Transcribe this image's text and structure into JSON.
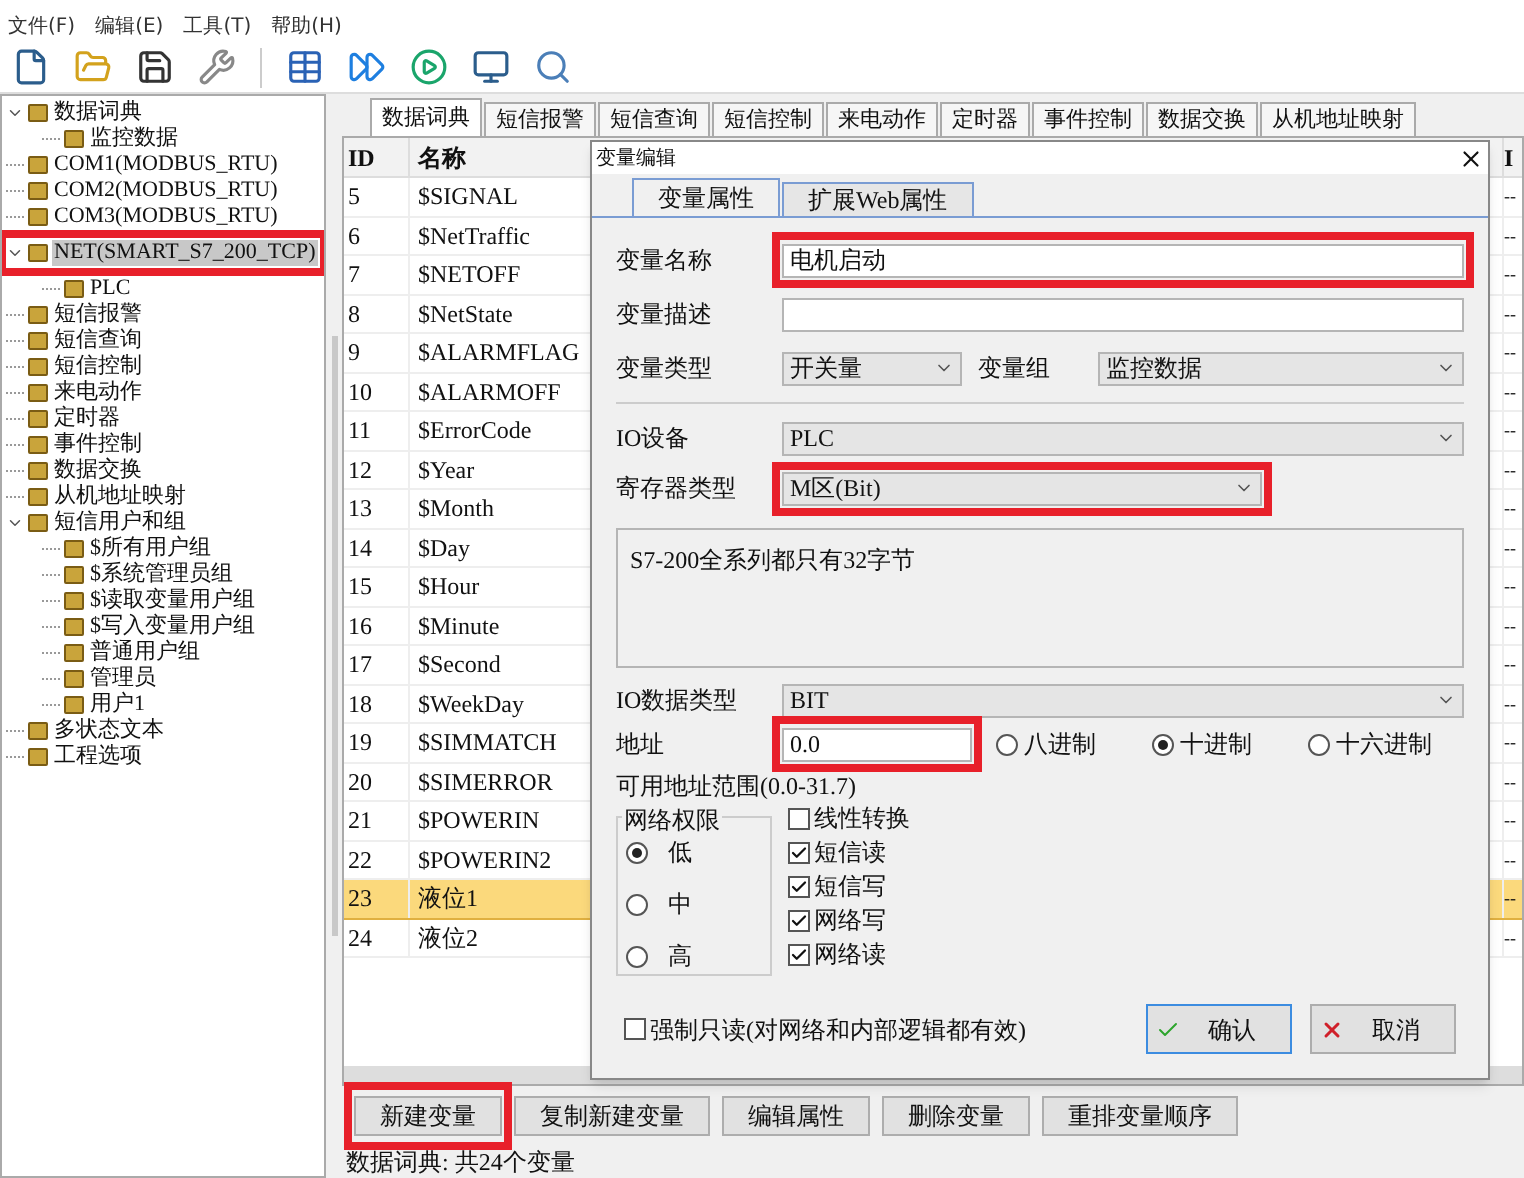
{
  "menu": [
    "文件(F)",
    "编辑(E)",
    "工具(T)",
    "帮助(H)"
  ],
  "tree": [
    {
      "label": "数据词典",
      "selected": false,
      "expanded": true,
      "children": [
        {
          "label": "监控数据",
          "selected": false
        }
      ]
    },
    {
      "label": "COM1(MODBUS_RTU)",
      "selected": false
    },
    {
      "label": "COM2(MODBUS_RTU)",
      "selected": false
    },
    {
      "label": "COM3(MODBUS_RTU)",
      "selected": false
    },
    {
      "label": "NET(SMART_S7_200_TCP)",
      "selected": true,
      "highlighted": true,
      "expanded": true,
      "children": [
        {
          "label": "PLC",
          "selected": false
        }
      ]
    },
    {
      "label": "短信报警",
      "selected": false
    },
    {
      "label": "短信查询",
      "selected": false
    },
    {
      "label": "短信控制",
      "selected": false
    },
    {
      "label": "来电动作",
      "selected": false
    },
    {
      "label": "定时器",
      "selected": false
    },
    {
      "label": "事件控制",
      "selected": false
    },
    {
      "label": "数据交换",
      "selected": false
    },
    {
      "label": "从机地址映射",
      "selected": false
    },
    {
      "label": "短信用户和组",
      "selected": false,
      "expanded": true,
      "children": [
        {
          "label": "$所有用户组",
          "selected": false
        },
        {
          "label": "$系统管理员组",
          "selected": false
        },
        {
          "label": "$读取变量用户组",
          "selected": false
        },
        {
          "label": "$写入变量用户组",
          "selected": false
        },
        {
          "label": "普通用户组",
          "selected": false
        },
        {
          "label": "管理员",
          "selected": false
        },
        {
          "label": "用户1",
          "selected": false
        }
      ]
    },
    {
      "label": "多状态文本",
      "selected": false
    },
    {
      "label": "工程选项",
      "selected": false
    }
  ],
  "tabs": [
    {
      "label": "数据词典",
      "selected": true
    },
    {
      "label": "短信报警",
      "selected": false
    },
    {
      "label": "短信查询",
      "selected": false
    },
    {
      "label": "短信控制",
      "selected": false
    },
    {
      "label": "来电动作",
      "selected": false
    },
    {
      "label": "定时器",
      "selected": false
    },
    {
      "label": "事件控制",
      "selected": false
    },
    {
      "label": "数据交换",
      "selected": false
    },
    {
      "label": "从机地址映射",
      "selected": false
    }
  ],
  "table": {
    "columns": [
      "ID",
      "名称",
      "I"
    ],
    "rows": [
      {
        "cells": [
          "5",
          "$SIGNAL",
          "--"
        ],
        "selected": false
      },
      {
        "cells": [
          "6",
          "$NetTraffic",
          "--"
        ],
        "selected": false
      },
      {
        "cells": [
          "7",
          "$NETOFF",
          "--"
        ],
        "selected": false
      },
      {
        "cells": [
          "8",
          "$NetState",
          "--"
        ],
        "selected": false
      },
      {
        "cells": [
          "9",
          "$ALARMFLAG",
          "--"
        ],
        "selected": false
      },
      {
        "cells": [
          "10",
          "$ALARMOFF",
          "--"
        ],
        "selected": false
      },
      {
        "cells": [
          "11",
          "$ErrorCode",
          "--"
        ],
        "selected": false
      },
      {
        "cells": [
          "12",
          "$Year",
          "--"
        ],
        "selected": false
      },
      {
        "cells": [
          "13",
          "$Month",
          "--"
        ],
        "selected": false
      },
      {
        "cells": [
          "14",
          "$Day",
          "--"
        ],
        "selected": false
      },
      {
        "cells": [
          "15",
          "$Hour",
          "--"
        ],
        "selected": false
      },
      {
        "cells": [
          "16",
          "$Minute",
          "--"
        ],
        "selected": false
      },
      {
        "cells": [
          "17",
          "$Second",
          "--"
        ],
        "selected": false
      },
      {
        "cells": [
          "18",
          "$WeekDay",
          "--"
        ],
        "selected": false
      },
      {
        "cells": [
          "19",
          "$SIMMATCH",
          "--"
        ],
        "selected": false
      },
      {
        "cells": [
          "20",
          "$SIMERROR",
          "--"
        ],
        "selected": false
      },
      {
        "cells": [
          "21",
          "$POWERIN",
          "--"
        ],
        "selected": false
      },
      {
        "cells": [
          "22",
          "$POWERIN2",
          "--"
        ],
        "selected": false
      },
      {
        "cells": [
          "23",
          "液位1",
          "--"
        ],
        "selected": true
      },
      {
        "cells": [
          "24",
          "液位2",
          "--"
        ],
        "selected": false
      }
    ]
  },
  "buttons": [
    {
      "label": "新建变量",
      "highlighted": true
    },
    {
      "label": "复制新建变量",
      "highlighted": false
    },
    {
      "label": "编辑属性",
      "highlighted": false
    },
    {
      "label": "删除变量",
      "highlighted": false
    },
    {
      "label": "重排变量顺序",
      "highlighted": false
    }
  ],
  "status_bar": "数据词典: 共24个变量",
  "dialog": {
    "title": "变量编辑",
    "tabs": [
      {
        "label": "变量属性",
        "selected": true
      },
      {
        "label": "扩展Web属性",
        "selected": false
      }
    ],
    "name": {
      "label": "变量名称",
      "value": "电机启动",
      "highlighted": true
    },
    "description": {
      "label": "变量描述"
    },
    "type": {
      "label": "变量类型",
      "value": "开关量"
    },
    "group": {
      "label": "变量组",
      "value": "监控数据"
    },
    "io_device": {
      "label": "IO设备",
      "value": "PLC"
    },
    "register_type": {
      "label": "寄存器类型",
      "value": "M区(Bit)",
      "highlighted": true
    },
    "note": "S7-200全系列都只有32字节",
    "io_data_type": {
      "label": "IO数据类型",
      "value": "BIT"
    },
    "address": {
      "label": "地址",
      "value": "0.0",
      "highlighted": true
    },
    "radix": [
      {
        "label": "八进制",
        "selected": false
      },
      {
        "label": "十进制",
        "selected": true
      },
      {
        "label": "十六进制",
        "selected": false
      }
    ],
    "range": "可用地址范围(0.0-31.7)",
    "permission": {
      "label": "网络权限",
      "options": [
        {
          "label": "低",
          "selected": true
        },
        {
          "label": "中",
          "selected": false
        },
        {
          "label": "高",
          "selected": false
        }
      ]
    },
    "options": [
      {
        "label": "线性转换",
        "checked": false
      },
      {
        "label": "短信读",
        "checked": true
      },
      {
        "label": "短信写",
        "checked": true
      },
      {
        "label": "网络写",
        "checked": true
      },
      {
        "label": "网络读",
        "checked": true
      }
    ],
    "readonly": {
      "label": "强制只读(对网络和内部逻辑都有效)",
      "checked": false
    },
    "ok": "确认",
    "cancel": "取消"
  }
}
